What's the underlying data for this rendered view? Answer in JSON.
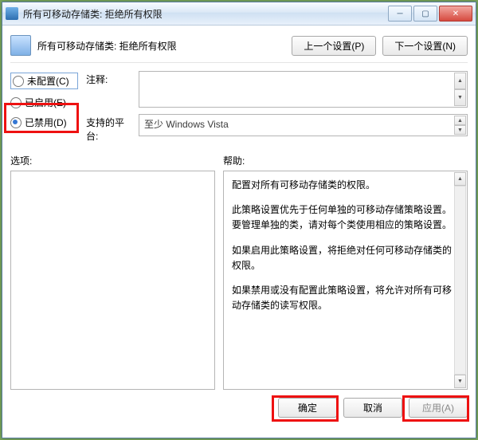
{
  "window": {
    "title": "所有可移动存储类: 拒绝所有权限"
  },
  "header": {
    "policy_title": "所有可移动存储类: 拒绝所有权限",
    "prev_btn": "上一个设置(P)",
    "next_btn": "下一个设置(N)"
  },
  "radios": {
    "not_configured": "未配置(C)",
    "enabled": "已启用(E)",
    "disabled": "已禁用(D)",
    "selected": "disabled"
  },
  "comment": {
    "label": "注释:",
    "value": ""
  },
  "supported": {
    "label": "支持的平台:",
    "value": "至少 Windows Vista"
  },
  "sections": {
    "options_label": "选项:",
    "help_label": "帮助:"
  },
  "help_text": {
    "p1": "配置对所有可移动存储类的权限。",
    "p2": "此策略设置优先于任何单独的可移动存储策略设置。要管理单独的类，请对每个类使用相应的策略设置。",
    "p3": "如果启用此策略设置，将拒绝对任何可移动存储类的权限。",
    "p4": "如果禁用或没有配置此策略设置，将允许对所有可移动存储类的读写权限。"
  },
  "footer": {
    "ok": "确定",
    "cancel": "取消",
    "apply": "应用(A)"
  }
}
